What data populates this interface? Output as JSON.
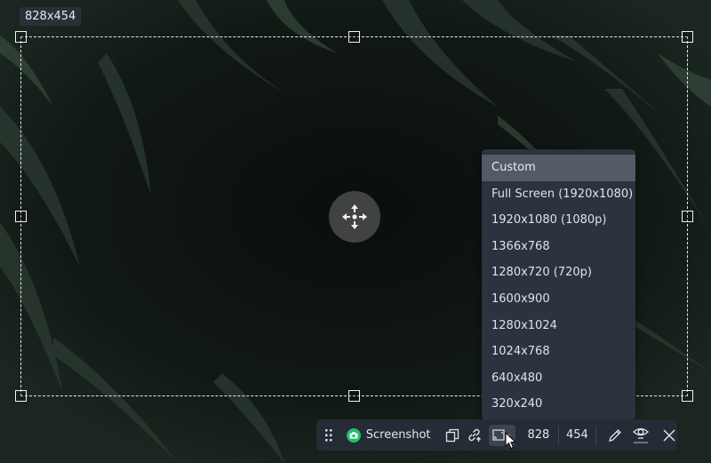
{
  "capture": {
    "size_label": "828x454",
    "width": "828",
    "height": "454"
  },
  "resolution_menu": {
    "selected": "Custom",
    "options": [
      "Custom",
      "Full Screen (1920x1080)",
      "1920x1080 (1080p)",
      "1366x768",
      "1280x720 (720p)",
      "1600x900",
      "1280x1024",
      "1024x768",
      "640x480",
      "320x240"
    ]
  },
  "toolbar": {
    "mode_label": "Screenshot",
    "icons": [
      "drag-grip-icon",
      "camera-icon",
      "copy-icon",
      "link-upload-icon",
      "resolution-icon",
      "pencil-icon",
      "eye-icon",
      "close-icon"
    ],
    "accent_color": "#1fbf6a"
  }
}
